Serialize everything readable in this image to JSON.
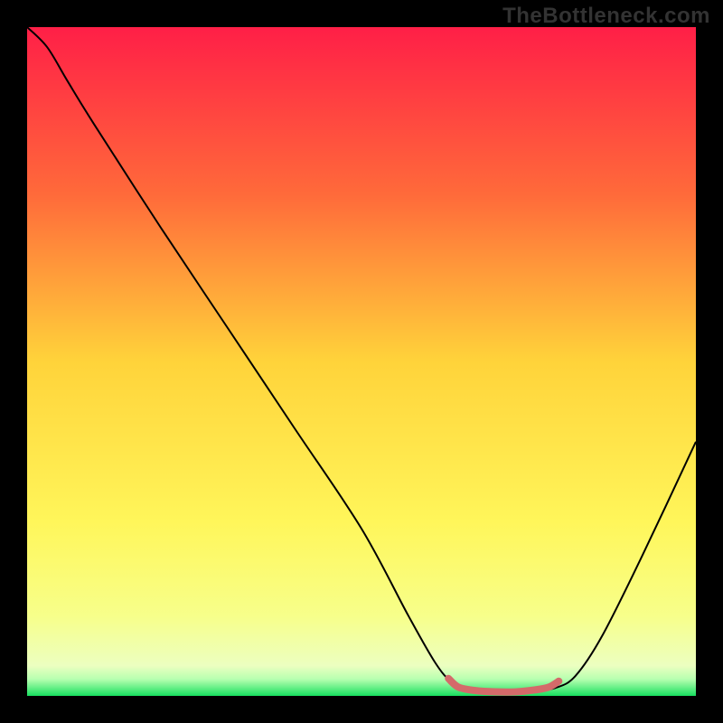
{
  "watermark": "TheBottleneck.com",
  "chart_data": {
    "type": "line",
    "title": "",
    "xlabel": "",
    "ylabel": "",
    "xlim": [
      0,
      100
    ],
    "ylim": [
      0,
      100
    ],
    "grid": false,
    "background_gradient": {
      "stops": [
        {
          "offset": 0.0,
          "color": "#ff1f47"
        },
        {
          "offset": 0.25,
          "color": "#ff6a3a"
        },
        {
          "offset": 0.5,
          "color": "#ffd33a"
        },
        {
          "offset": 0.74,
          "color": "#fff65a"
        },
        {
          "offset": 0.88,
          "color": "#f7ff8a"
        },
        {
          "offset": 0.955,
          "color": "#ecffc0"
        },
        {
          "offset": 0.975,
          "color": "#b7ffb0"
        },
        {
          "offset": 1.0,
          "color": "#18e060"
        }
      ]
    },
    "series": [
      {
        "name": "bottleneck-curve",
        "stroke": "#000000",
        "stroke_width": 2,
        "points": [
          {
            "x": 0.0,
            "y": 100.0
          },
          {
            "x": 3.0,
            "y": 97.0
          },
          {
            "x": 6.0,
            "y": 92.0
          },
          {
            "x": 10.0,
            "y": 85.5
          },
          {
            "x": 20.0,
            "y": 70.0
          },
          {
            "x": 30.0,
            "y": 55.0
          },
          {
            "x": 40.0,
            "y": 40.0
          },
          {
            "x": 50.0,
            "y": 25.0
          },
          {
            "x": 57.0,
            "y": 12.0
          },
          {
            "x": 61.0,
            "y": 5.0
          },
          {
            "x": 63.5,
            "y": 2.0
          },
          {
            "x": 66.0,
            "y": 0.8
          },
          {
            "x": 70.0,
            "y": 0.5
          },
          {
            "x": 75.0,
            "y": 0.6
          },
          {
            "x": 79.0,
            "y": 1.2
          },
          {
            "x": 82.0,
            "y": 3.0
          },
          {
            "x": 86.0,
            "y": 9.0
          },
          {
            "x": 92.0,
            "y": 21.0
          },
          {
            "x": 100.0,
            "y": 38.0
          }
        ]
      },
      {
        "name": "optimal-range-marker",
        "stroke": "#d46a6a",
        "stroke_width": 8,
        "linecap": "round",
        "points": [
          {
            "x": 63.0,
            "y": 2.6
          },
          {
            "x": 64.5,
            "y": 1.3
          },
          {
            "x": 67.0,
            "y": 0.8
          },
          {
            "x": 70.0,
            "y": 0.6
          },
          {
            "x": 73.0,
            "y": 0.6
          },
          {
            "x": 76.0,
            "y": 0.9
          },
          {
            "x": 78.0,
            "y": 1.3
          },
          {
            "x": 79.5,
            "y": 2.2
          }
        ]
      }
    ]
  }
}
